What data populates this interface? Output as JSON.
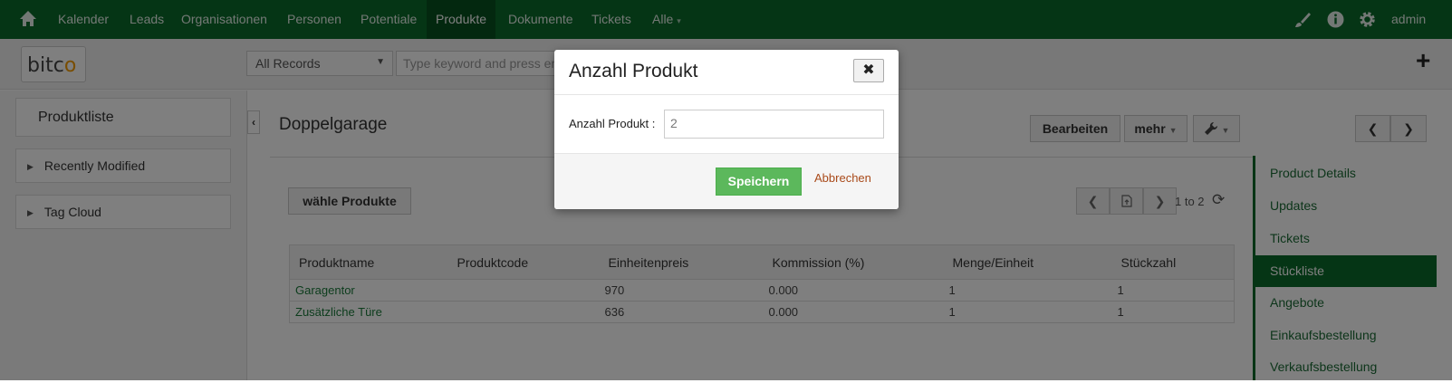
{
  "nav": {
    "items": [
      "Kalender",
      "Leads",
      "Organisationen",
      "Personen",
      "Potentiale",
      "Produkte",
      "Dokumente",
      "Tickets",
      "Alle"
    ],
    "active": "Produkte",
    "user": "admin",
    "icons": [
      "home-icon",
      "brush-icon",
      "info-icon",
      "gear-icon"
    ]
  },
  "subbar": {
    "logo_text": "bitc",
    "logo_dot": "o",
    "records_select": "All Records",
    "search_placeholder": "Type keyword and press enter"
  },
  "sidebar": {
    "title": "Produktliste",
    "sections": [
      "Recently Modified",
      "Tag Cloud"
    ]
  },
  "record": {
    "title": "Doppelgarage",
    "edit_label": "Bearbeiten",
    "more_label": "mehr"
  },
  "related": {
    "choose_label": "wähle Produkte",
    "count_text": "1 to 2",
    "columns": [
      "Produktname",
      "Produktcode",
      "Einheitenpreis",
      "Kommission (%)",
      "Menge/Einheit",
      "Stückzahl"
    ],
    "rows": [
      [
        "Garagentor",
        "",
        "970",
        "0.000",
        "1",
        "1"
      ],
      [
        "Zusätzliche Türe",
        "",
        "636",
        "0.000",
        "1",
        "1"
      ]
    ]
  },
  "right_panel": {
    "items": [
      "Product Details",
      "Updates",
      "Tickets",
      "Stückliste",
      "Angebote",
      "Einkaufsbestellung",
      "Verkaufsbestellung"
    ],
    "active": "Stückliste"
  },
  "modal": {
    "title": "Anzahl Produkt",
    "field_label": "Anzahl Produkt :",
    "field_value": "2",
    "save_label": "Speichern",
    "cancel_label": "Abbrechen"
  },
  "colors": {
    "primary": "#0b6a2a",
    "success": "#5cb85c"
  }
}
